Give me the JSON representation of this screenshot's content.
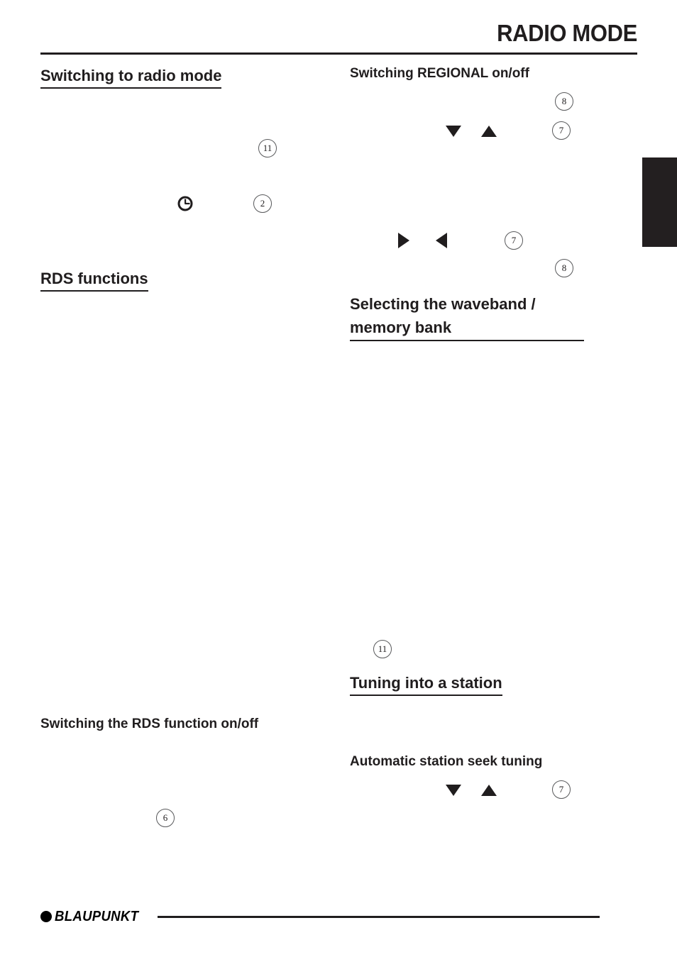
{
  "document": {
    "header_title": "RADIO MODE",
    "footer_brand": "BLAUPUNKT"
  },
  "left_column": {
    "headings": [
      {
        "text": "Switching to radio mode",
        "underlined": true
      },
      {
        "text": "RDS functions",
        "underlined": true
      }
    ],
    "subheadings": [
      {
        "text": "Switching the RDS function on/off"
      }
    ],
    "reference_numbers": [
      "11",
      "2",
      "6"
    ],
    "icons": [
      "clock-icon"
    ]
  },
  "right_column": {
    "headings": [
      {
        "text": "Selecting the waveband / memory bank",
        "underlined": true
      },
      {
        "text": "Tuning into a station",
        "underlined": true
      }
    ],
    "subheadings": [
      {
        "text": "Switching REGIONAL on/off"
      },
      {
        "text": "Automatic station seek tuning"
      }
    ],
    "reference_numbers": [
      "8",
      "7",
      "7",
      "8",
      "11",
      "7"
    ],
    "icons": [
      "arrow-down-icon",
      "arrow-up-icon",
      "arrow-right-icon",
      "arrow-left-icon",
      "arrow-down-icon",
      "arrow-up-icon"
    ]
  },
  "refs": {
    "r11a": "11",
    "r2": "2",
    "r6": "6",
    "r8a": "8",
    "r7a": "7",
    "r7b": "7",
    "r8b": "8",
    "r11b": "11",
    "r7c": "7"
  },
  "headings": {
    "switching_to_radio_mode": "Switching to radio mode",
    "rds_functions": "RDS functions",
    "switching_rds_on_off": "Switching the RDS function on/off",
    "switching_regional_on_off": "Switching REGIONAL on/off",
    "selecting_waveband": "Selecting the waveband / memory bank",
    "tuning_into_station": "Tuning into a station",
    "automatic_seek_tuning": "Automatic station seek tuning"
  },
  "colors": {
    "ink": "#201d1e",
    "tab": "#231f20",
    "circle_stroke": "#58595b",
    "page": "#ffffff"
  }
}
